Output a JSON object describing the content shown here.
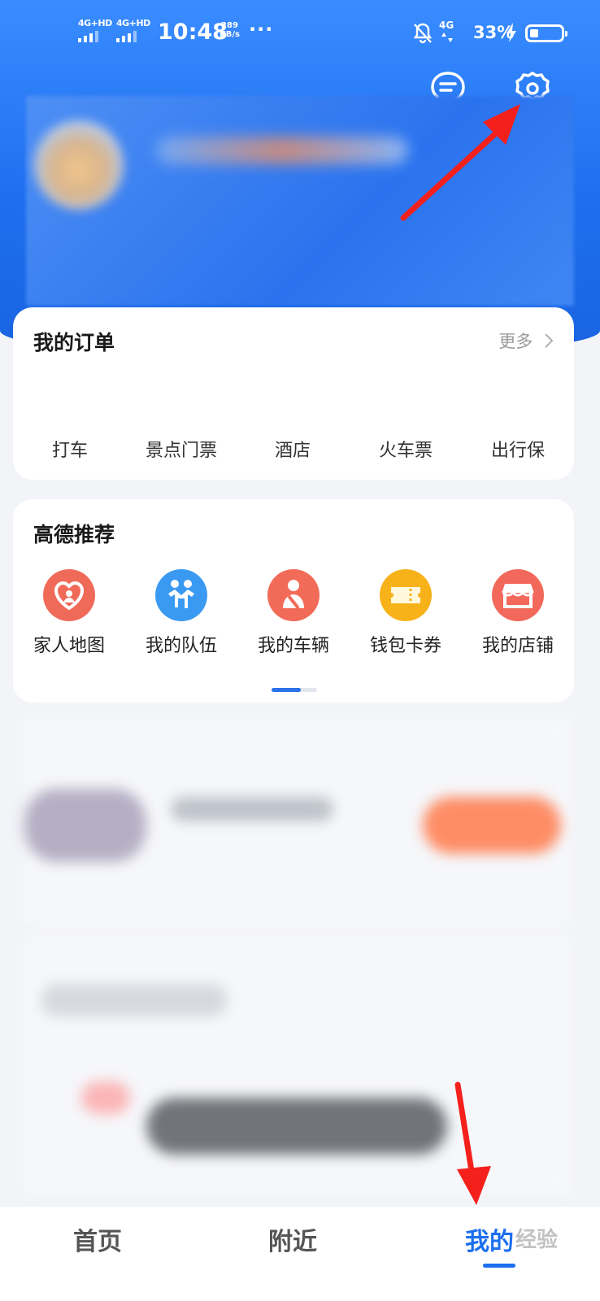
{
  "colors": {
    "brand": "#1d6ff0",
    "arrow": "#f4201c"
  },
  "status_bar": {
    "sim1": "4G+HD",
    "sim2": "4G+HD",
    "time": "10:48",
    "speed_value": "289",
    "speed_unit": "KB/s",
    "more": "···",
    "network": "4G",
    "battery": "33%"
  },
  "header_icons": {
    "message": "message-icon",
    "settings": "gear-icon"
  },
  "orders": {
    "title": "我的订单",
    "more": "更多",
    "items": [
      "打车",
      "景点门票",
      "酒店",
      "火车票",
      "出行保"
    ]
  },
  "recommend": {
    "title": "高德推荐",
    "items": [
      {
        "label": "家人地图",
        "color": "#f06a5a",
        "icon": "heart-family-icon"
      },
      {
        "label": "我的队伍",
        "color": "#3a9af2",
        "icon": "team-icon"
      },
      {
        "label": "我的车辆",
        "color": "#f26b58",
        "icon": "driver-icon"
      },
      {
        "label": "钱包卡券",
        "color": "#f7b21a",
        "icon": "ticket-icon"
      },
      {
        "label": "我的店铺",
        "color": "#f2685a",
        "icon": "shop-icon"
      }
    ]
  },
  "tabbar": {
    "tabs": [
      "首页",
      "附近",
      "我的"
    ],
    "active": "我的"
  },
  "watermark": "经验"
}
